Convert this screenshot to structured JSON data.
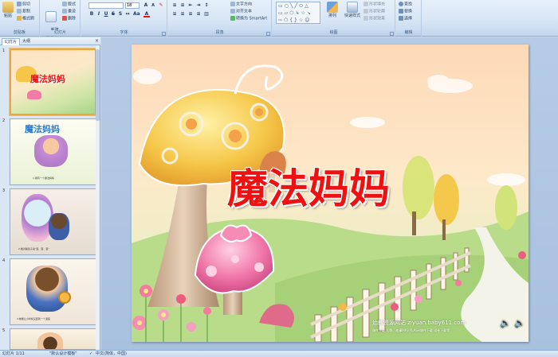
{
  "ribbon": {
    "clipboard": {
      "paste": "粘贴",
      "cut": "剪切",
      "copy": "复制",
      "format_painter": "格式刷",
      "label": "剪贴板"
    },
    "slides": {
      "new_slide": "新建\n幻灯片",
      "layout": "版式",
      "reset": "重设",
      "delete": "删除",
      "label": "幻灯片"
    },
    "font": {
      "size": "18",
      "label": "字体"
    },
    "paragraph": {
      "text_direction": "文字方向",
      "align_text": "对齐文本",
      "smartart": "转换为 SmartArt",
      "label": "段落"
    },
    "drawing": {
      "arrange": "排列",
      "quick_styles": "快速样式",
      "shape_fill": "形状填充",
      "shape_outline": "形状轮廓",
      "shape_effects": "形状效果",
      "label": "绘图"
    },
    "editing": {
      "find": "查找",
      "replace": "替换",
      "select": "选择",
      "label": "编辑"
    }
  },
  "panel": {
    "tab_slides": "幻灯片",
    "tab_outline": "大纲",
    "thumbs": [
      {
        "num": "1",
        "title": "魔法妈妈"
      },
      {
        "num": "2",
        "title": "魔法妈妈",
        "caption": "1.我有一个魔法妈妈"
      },
      {
        "num": "3",
        "caption": "2.她对着镜子说“变、变、变”"
      },
      {
        "num": "4",
        "caption": "3.她能让小时候又回到一个温度"
      },
      {
        "num": "5"
      }
    ]
  },
  "slide": {
    "title": "魔法妈妈",
    "watermark": "幼教资源网站 ziyuan.baby611.com",
    "watermark_sub": "课件下载 儿歌、故事MP3 FLASH课件下载 试卷下载等"
  },
  "status": {
    "slide_count": "幻灯片 1/11",
    "theme": "\"默认设计模板\"",
    "language": "中文(简体，中国)"
  },
  "colors": {
    "title_red": "#ee1111",
    "selection_orange": "#f2a43a",
    "ribbon_blue": "#d6e5f5"
  }
}
